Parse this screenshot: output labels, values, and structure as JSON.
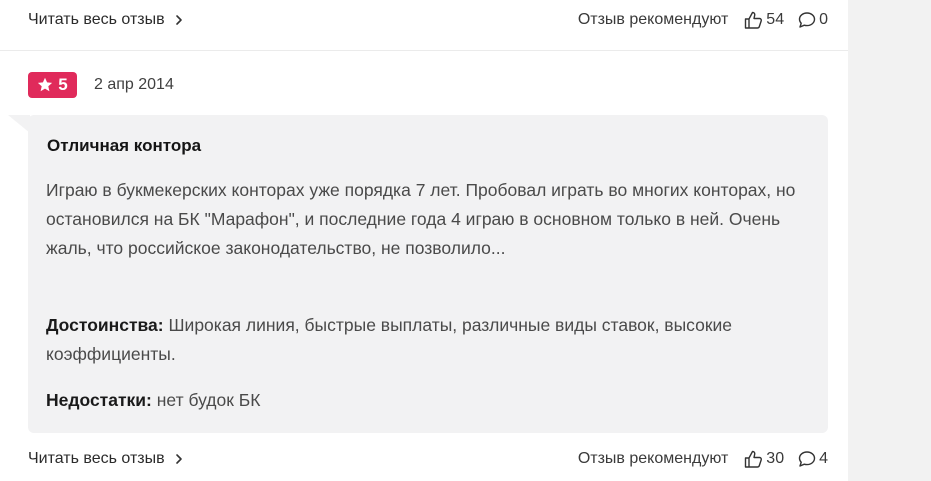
{
  "previous_review_footer": {
    "read_more": "Читать весь отзыв",
    "recommend_label": "Отзыв рекомендуют",
    "likes": "54",
    "comments": "0"
  },
  "review": {
    "rating": "5",
    "date": "2 апр 2014",
    "title": "Отличная контора",
    "text": "Играю в букмекерских конторах уже порядка 7 лет. Пробовал играть во многих конторах, но остановился на БК \"Марафон\", и последние года 4 играю в основном только в ней. Очень жаль, что российское законодательство, не позволило...",
    "pros_label": "Достоинства:",
    "pros": "Широкая линия, быстрые выплаты, различные виды ставок, высокие коэффициенты.",
    "cons_label": "Недостатки:",
    "cons": "нет будок БК",
    "footer": {
      "read_more": "Читать весь отзыв",
      "recommend_label": "Отзыв рекомендуют",
      "likes": "30",
      "comments": "4"
    }
  },
  "colors": {
    "badge": "#e02a5b",
    "bubble": "#f2f2f3",
    "gutter": "#f2f2f2"
  },
  "icons": [
    "chevron-right-icon",
    "thumbs-up-icon",
    "comment-icon",
    "star-icon"
  ]
}
